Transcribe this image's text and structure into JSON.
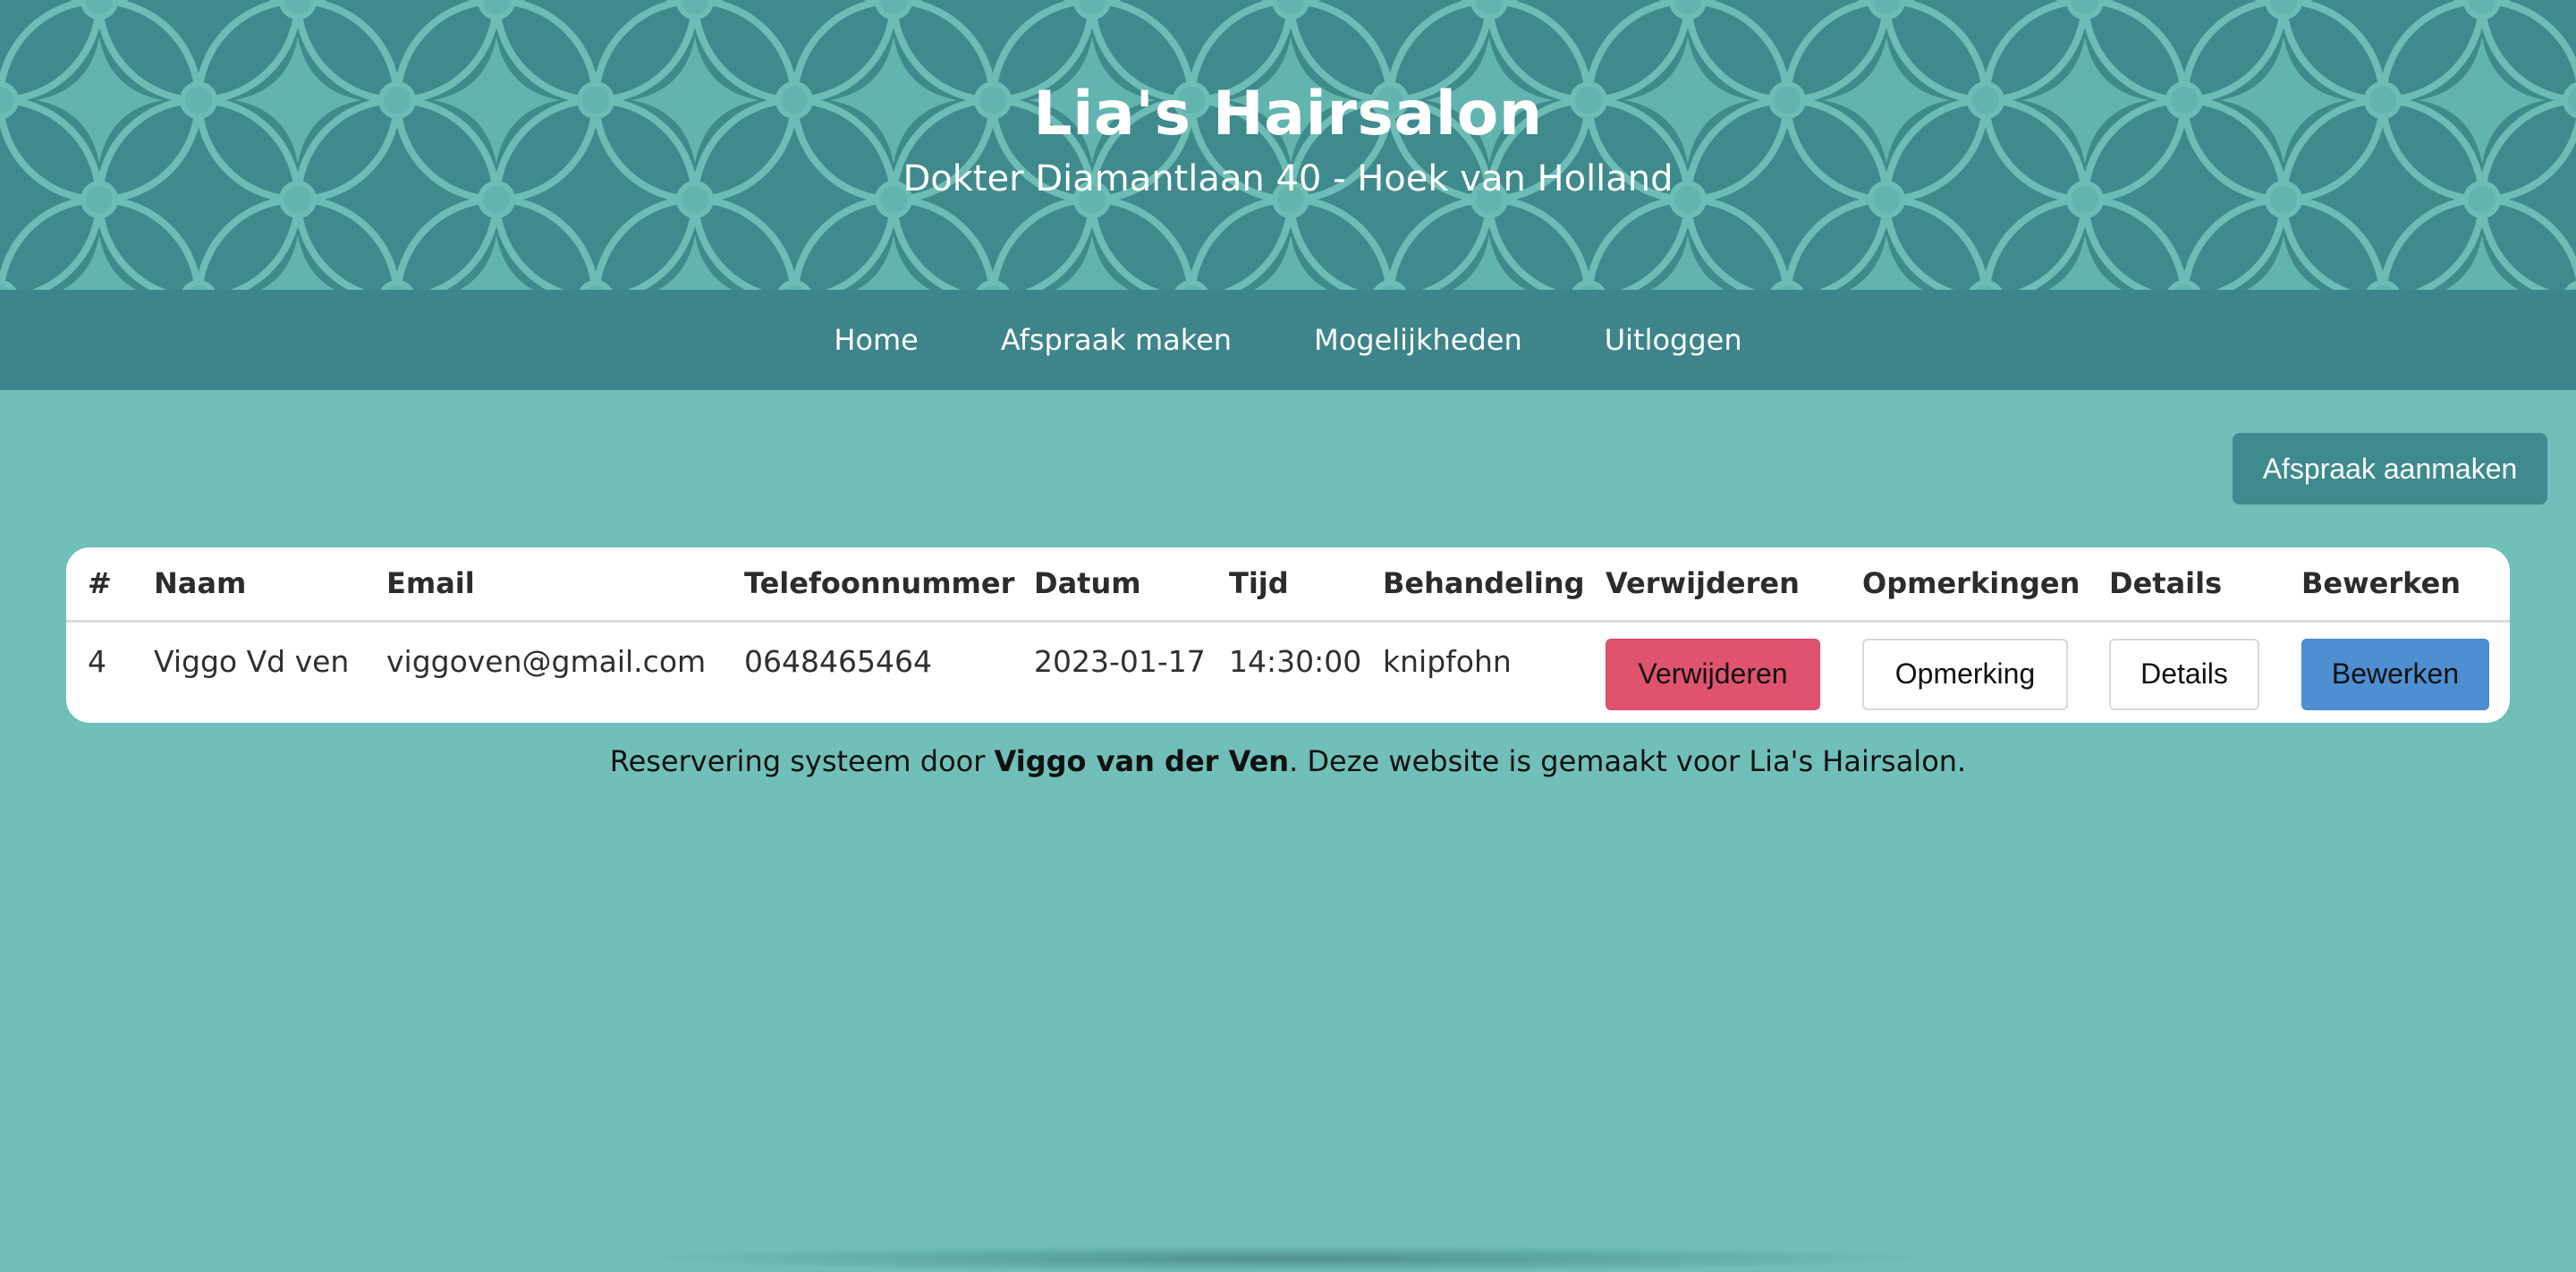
{
  "header": {
    "title": "Lia's Hairsalon",
    "subtitle": "Dokter Diamantlaan 40 - Hoek van Holland"
  },
  "nav": {
    "items": [
      {
        "label": "Home"
      },
      {
        "label": "Afspraak maken"
      },
      {
        "label": "Mogelijkheden"
      },
      {
        "label": "Uitloggen"
      }
    ]
  },
  "actions": {
    "create_label": "Afspraak aanmaken"
  },
  "table": {
    "headers": [
      "#",
      "Naam",
      "Email",
      "Telefoonnummer",
      "Datum",
      "Tijd",
      "Behandeling",
      "Verwijderen",
      "Opmerkingen",
      "Details",
      "Bewerken"
    ],
    "rows": [
      {
        "id": "4",
        "naam": "Viggo Vd ven",
        "email": "viggoven@gmail.com",
        "telefoon": "0648465464",
        "datum": "2023-01-17",
        "tijd": "14:30:00",
        "behandeling": "knipfohn",
        "delete_label": "Verwijderen",
        "remark_label": "Opmerking",
        "details_label": "Details",
        "edit_label": "Bewerken"
      }
    ]
  },
  "footer": {
    "prefix": "Reservering systeem door ",
    "author": "Viggo van der Ven",
    "suffix": ". Deze website is gemaakt voor Lia's Hairsalon."
  },
  "colors": {
    "page_bg": "#70bfb8",
    "header_bg": "#3f8a8c",
    "nav_bg": "#3e848b",
    "delete": "#e0536e",
    "edit": "#4d8fd1"
  }
}
